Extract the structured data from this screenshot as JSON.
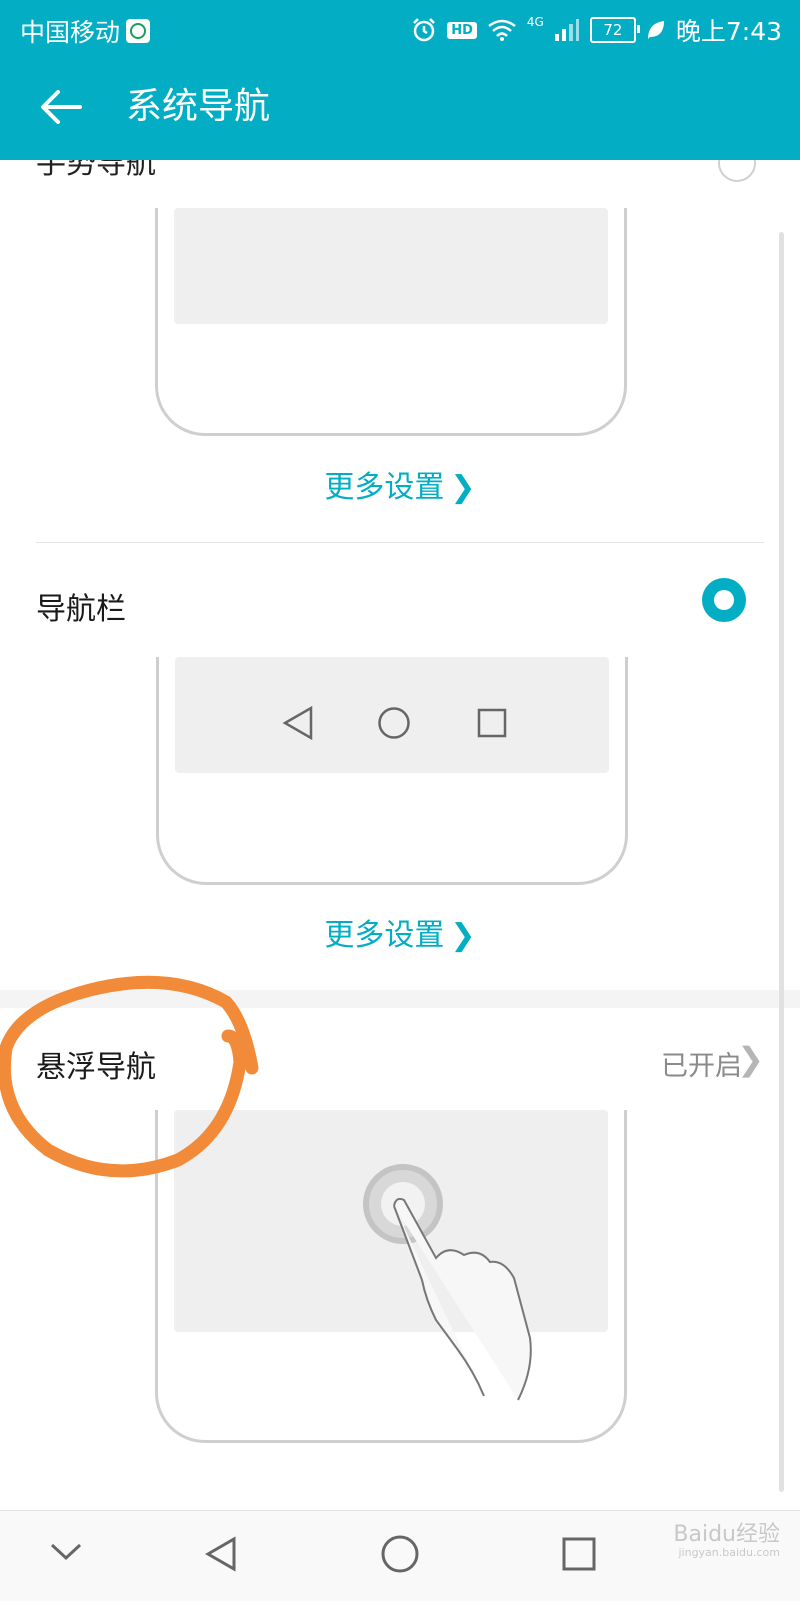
{
  "status_bar": {
    "carrier": "中国移动",
    "hd": "HD",
    "network": "4G",
    "battery": "72",
    "time": "晚上7:43"
  },
  "app_bar": {
    "title": "系统导航",
    "back_icon": "arrow-left-icon"
  },
  "sections": {
    "gesture": {
      "title": "手势导航",
      "selected": false,
      "more_label": "更多设置"
    },
    "navbar": {
      "title": "导航栏",
      "selected": true,
      "more_label": "更多设置"
    },
    "floating": {
      "title": "悬浮导航",
      "status": "已开启"
    }
  },
  "system_nav": [
    "chevron-down-icon",
    "back-triangle-icon",
    "home-circle-icon",
    "recents-square-icon"
  ],
  "watermark": {
    "text": "Baidu经验",
    "sub": "jingyan.baidu.com"
  },
  "colors": {
    "accent": "#03aec5",
    "annotation": "#f28b39"
  }
}
